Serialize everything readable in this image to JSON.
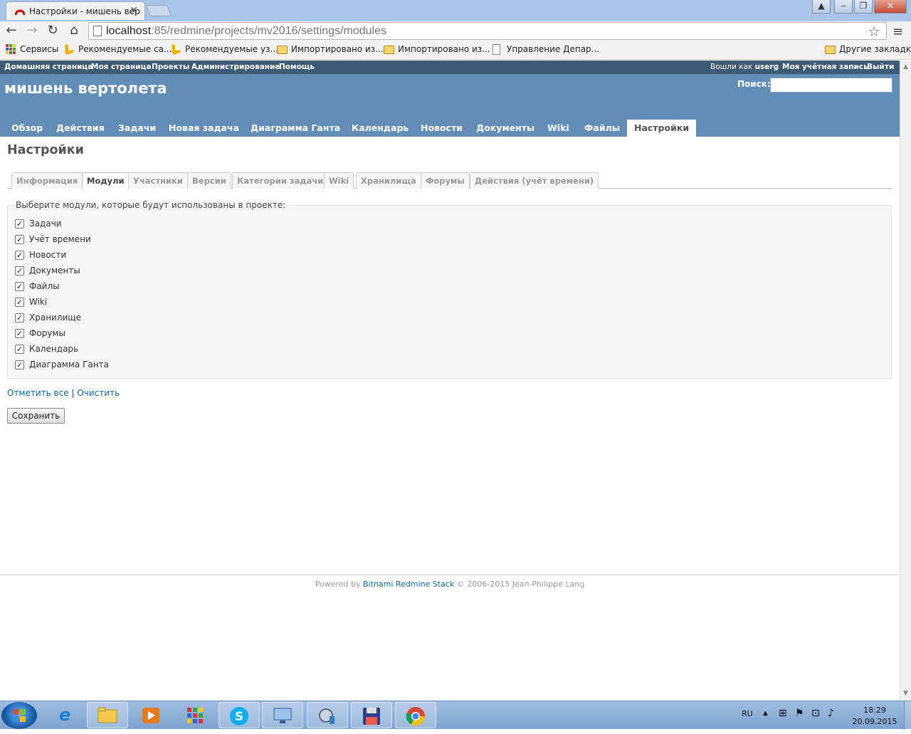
{
  "browser": {
    "tab_title": "Настройки - мишень вер",
    "tab_close": "✕",
    "url_host": "localhost",
    "url_path": ":85/redmine/projects/mv2016/settings/modules",
    "bookmarks": [
      "Сервисы",
      "Рекомендуемые са...",
      "Рекомендуемые уз...",
      "Импортировано из...",
      "Импортировано из...",
      "Управление Депар..."
    ],
    "other_bookmarks": "Другие закладки"
  },
  "top_menu": {
    "left": [
      "Домашняя страница",
      "Моя страница",
      "Проекты",
      "Администрирование",
      "Помощь"
    ],
    "logged_in_prefix": "Вошли как",
    "logged_in_user": "userg",
    "my_account": "Моя учётная запись",
    "logout": "Выйти"
  },
  "header": {
    "project_title": "мишень вертолета",
    "search_label": "Поиск:"
  },
  "main_menu": [
    "Обзор",
    "Действия",
    "Задачи",
    "Новая задача",
    "Диаграмма Ганта",
    "Календарь",
    "Новости",
    "Документы",
    "Wiki",
    "Файлы",
    "Настройки"
  ],
  "page_title": "Настройки",
  "settings_tabs": [
    "Информация",
    "Модули",
    "Участники",
    "Версии",
    "Категории задачи",
    "Wiki",
    "Хранилища",
    "Форумы",
    "Действия (учёт времени)"
  ],
  "selected_tab": "Модули",
  "modules": {
    "legend": "Выберите модули, которые будут использованы в проекте:",
    "items": [
      {
        "label": "Задачи",
        "checked": true
      },
      {
        "label": "Учёт времени",
        "checked": true
      },
      {
        "label": "Новости",
        "checked": true
      },
      {
        "label": "Документы",
        "checked": true
      },
      {
        "label": "Файлы",
        "checked": true
      },
      {
        "label": "Wiki",
        "checked": true
      },
      {
        "label": "Хранилище",
        "checked": true
      },
      {
        "label": "Форумы",
        "checked": true
      },
      {
        "label": "Календарь",
        "checked": true
      },
      {
        "label": "Диаграмма Ганта",
        "checked": true
      }
    ]
  },
  "actions": {
    "check_all": "Отметить все",
    "separator": "|",
    "clear": "Очистить",
    "save": "Сохранить"
  },
  "footer": {
    "prefix": "Powered by",
    "link": "Bitnami Redmine Stack",
    "suffix": "© 2006-2015 Jean-Philippe Lang"
  },
  "taskbar": {
    "lang": "RU",
    "time": "18:29",
    "date": "20.09.2015"
  }
}
